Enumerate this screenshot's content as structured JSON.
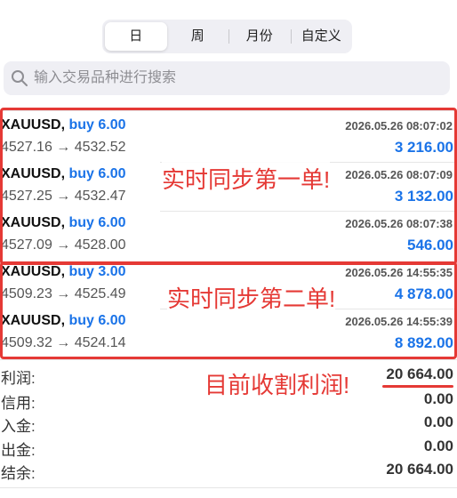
{
  "tabs": [
    {
      "label": "日",
      "active": true
    },
    {
      "label": "周",
      "active": false
    },
    {
      "label": "月份",
      "active": false
    },
    {
      "label": "自定义",
      "active": false
    }
  ],
  "search": {
    "placeholder": "输入交易品种进行搜索"
  },
  "trades": [
    {
      "symbol": "XAUUSD,",
      "action": "buy 6.00",
      "time": "2026.05.26 08:07:02",
      "prices": "4527.16 → 4532.52",
      "profit": "3 216.00"
    },
    {
      "symbol": "XAUUSD,",
      "action": "buy 6.00",
      "time": "2026.05.26 08:07:09",
      "prices": "4527.25 → 4532.47",
      "profit": "3 132.00"
    },
    {
      "symbol": "XAUUSD,",
      "action": "buy 6.00",
      "time": "2026.05.26 08:07:38",
      "prices": "4527.09 → 4528.00",
      "profit": "546.00"
    },
    {
      "symbol": "XAUUSD,",
      "action": "buy 3.00",
      "time": "2026.05.26 14:55:35",
      "prices": "4509.23 → 4525.49",
      "profit": "4 878.00"
    },
    {
      "symbol": "XAUUSD,",
      "action": "buy 6.00",
      "time": "2026.05.26 14:55:39",
      "prices": "4509.32 → 4524.14",
      "profit": "8 892.00"
    }
  ],
  "annotations": {
    "first": "实时同步第一单!",
    "second": "实时同步第二单!",
    "profit": "目前收割利润!"
  },
  "summary": [
    {
      "label": "利润:",
      "value": "20 664.00"
    },
    {
      "label": "信用:",
      "value": "0.00"
    },
    {
      "label": "入金:",
      "value": "0.00"
    },
    {
      "label": "出金:",
      "value": "0.00"
    },
    {
      "label": "结余:",
      "value": "20 664.00"
    }
  ],
  "colors": {
    "accent": "#1a73e8",
    "annotation": "#e53935"
  },
  "icons": {
    "search": "search-icon"
  }
}
